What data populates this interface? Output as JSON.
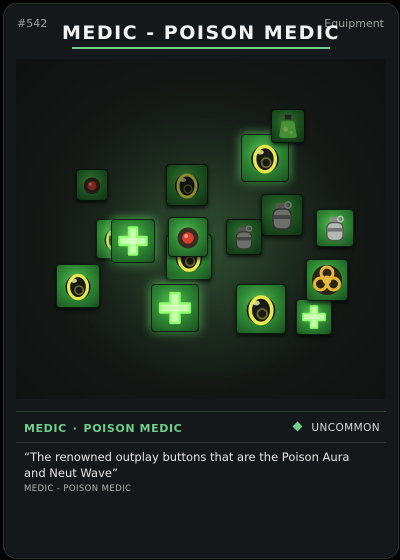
{
  "card": {
    "number": "#542",
    "category": "Equipment",
    "title": "MEDIC - POISON MEDIC",
    "class_name": "MEDIC",
    "separator": "·",
    "subclass_name": "POISON MEDIC",
    "rarity": "UNCOMMON",
    "flavor_text": "“The renowned outplay buttons that are the Poison Aura and Neut Wave”",
    "subline": "MEDIC - POISON MEDIC"
  },
  "colors": {
    "accent": "#6ed08a",
    "card_bg": "#15181b",
    "tile_green": "#2f8a34",
    "medic_cross": "#7dff5a"
  },
  "art": {
    "tiles": [
      {
        "icon": "grenade-icon"
      },
      {
        "icon": "grenade-icon"
      },
      {
        "icon": "grenade-icon"
      },
      {
        "icon": "grenade-icon"
      },
      {
        "icon": "grenade-icon"
      },
      {
        "icon": "grenade-icon"
      },
      {
        "icon": "poison-flask-icon"
      },
      {
        "icon": "gas-grenade-icon"
      },
      {
        "icon": "gas-grenade-icon"
      },
      {
        "icon": "medic-cross-icon"
      },
      {
        "icon": "medic-cross-icon"
      },
      {
        "icon": "medic-cross-icon"
      },
      {
        "icon": "biohazard-icon"
      },
      {
        "icon": "mine-icon"
      },
      {
        "icon": "mine-icon"
      },
      {
        "icon": "gas-grenade-icon"
      }
    ]
  }
}
